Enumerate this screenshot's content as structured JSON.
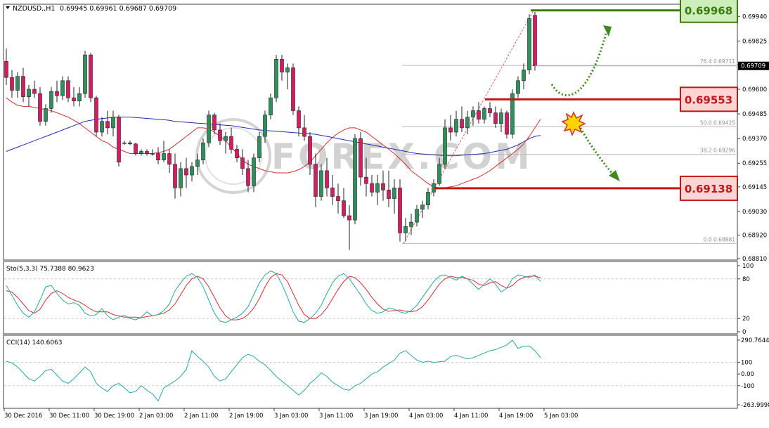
{
  "chart_data": {
    "type": "candlestick",
    "symbol_header": "NZDUSD,,H1",
    "ohlc_header": "0.69945 0.69961 0.69687 0.69709",
    "main": {
      "ylim": [
        0.6881,
        0.6999
      ],
      "yticks": [
        0.6881,
        0.6892,
        0.6903,
        0.69145,
        0.69255,
        0.6937,
        0.69485,
        0.696,
        0.69715,
        0.69825,
        0.6994
      ],
      "ytick_labels": [
        "0.68810",
        "0.68920",
        "0.69030",
        "0.69145",
        "0.69255",
        "0.69370",
        "0.69485",
        "0.69600",
        "0.69715",
        "0.69825",
        "0.69940"
      ],
      "current_price": 0.69709,
      "current_price_label": "0.69709",
      "fib_levels": [
        {
          "label": "76.4  0.69711",
          "value": 0.69711
        },
        {
          "label": "50.0  0.69425",
          "value": 0.69425
        },
        {
          "label": "38.2  0.69296",
          "value": 0.69296
        },
        {
          "label": "0.0  0.68881",
          "value": 0.68881
        }
      ],
      "levels": [
        {
          "label": "0.69968",
          "value": 0.69968,
          "kind": "resistance",
          "color": "#3a7a10",
          "fill": "#cdeeb8"
        },
        {
          "label": "0.69553",
          "value": 0.69553,
          "kind": "pivot",
          "color": "#c01818",
          "fill": "#ffd4d4"
        },
        {
          "label": "0.69138",
          "value": 0.69138,
          "kind": "support",
          "color": "#c01818",
          "fill": "#ffd4d4"
        }
      ],
      "candles": [
        [
          0.6973,
          0.6979,
          0.6962,
          0.69655
        ],
        [
          0.69655,
          0.6969,
          0.6956,
          0.69595
        ],
        [
          0.69595,
          0.6968,
          0.6956,
          0.6966
        ],
        [
          0.6966,
          0.697,
          0.6954,
          0.69565
        ],
        [
          0.69565,
          0.6962,
          0.6952,
          0.696
        ],
        [
          0.696,
          0.6964,
          0.6956,
          0.6958
        ],
        [
          0.6958,
          0.6961,
          0.6943,
          0.6945
        ],
        [
          0.6945,
          0.6953,
          0.6943,
          0.6951
        ],
        [
          0.6951,
          0.6961,
          0.6949,
          0.6959
        ],
        [
          0.6959,
          0.6964,
          0.6954,
          0.6957
        ],
        [
          0.6957,
          0.6966,
          0.6955,
          0.6964
        ],
        [
          0.6964,
          0.6966,
          0.6954,
          0.6956
        ],
        [
          0.6956,
          0.6961,
          0.6952,
          0.69545
        ],
        [
          0.69545,
          0.6961,
          0.6952,
          0.6958
        ],
        [
          0.6958,
          0.6978,
          0.6956,
          0.6976
        ],
        [
          0.6976,
          0.6977,
          0.6954,
          0.6956
        ],
        [
          0.6956,
          0.6957,
          0.6938,
          0.694
        ],
        [
          0.694,
          0.6947,
          0.6938,
          0.6945
        ],
        [
          0.6945,
          0.695,
          0.6939,
          0.6942
        ],
        [
          0.6942,
          0.695,
          0.6938,
          0.6947
        ],
        [
          0.6947,
          0.6948,
          0.6924,
          0.6926
        ],
        [
          0.6935,
          0.6936,
          0.6934,
          0.6935
        ],
        [
          0.6935,
          0.6936,
          0.6934,
          0.69345
        ],
        [
          0.69345,
          0.6935,
          0.6929,
          0.693
        ],
        [
          0.693,
          0.6932,
          0.6929,
          0.6931
        ],
        [
          0.6931,
          0.6932,
          0.6929,
          0.693
        ],
        [
          0.693,
          0.6932,
          0.6929,
          0.693
        ],
        [
          0.693,
          0.6933,
          0.6925,
          0.6927
        ],
        [
          0.6927,
          0.6936,
          0.6926,
          0.693
        ],
        [
          0.693,
          0.6932,
          0.6921,
          0.6925
        ],
        [
          0.6925,
          0.693,
          0.6909,
          0.6914
        ],
        [
          0.6914,
          0.6926,
          0.691,
          0.6923
        ],
        [
          0.6923,
          0.6928,
          0.6914,
          0.692
        ],
        [
          0.692,
          0.6926,
          0.6917,
          0.6924
        ],
        [
          0.6924,
          0.693,
          0.692,
          0.6927
        ],
        [
          0.6927,
          0.6937,
          0.6925,
          0.6935
        ],
        [
          0.6935,
          0.695,
          0.6933,
          0.6948
        ],
        [
          0.6948,
          0.6949,
          0.6939,
          0.6941
        ],
        [
          0.6941,
          0.6944,
          0.6934,
          0.6936
        ],
        [
          0.6936,
          0.694,
          0.693,
          0.6938
        ],
        [
          0.6938,
          0.6942,
          0.693,
          0.6932
        ],
        [
          0.6932,
          0.6934,
          0.6926,
          0.6928
        ],
        [
          0.6928,
          0.6932,
          0.692,
          0.6923
        ],
        [
          0.6923,
          0.6927,
          0.6912,
          0.6915
        ],
        [
          0.6915,
          0.693,
          0.6912,
          0.6928
        ],
        [
          0.6928,
          0.694,
          0.6926,
          0.6938
        ],
        [
          0.6938,
          0.695,
          0.6935,
          0.6948
        ],
        [
          0.6948,
          0.6958,
          0.6946,
          0.6956
        ],
        [
          0.6956,
          0.6976,
          0.6954,
          0.6974
        ],
        [
          0.6974,
          0.6976,
          0.6964,
          0.6968
        ],
        [
          0.6968,
          0.6972,
          0.696,
          0.697
        ],
        [
          0.697,
          0.6972,
          0.6948,
          0.695
        ],
        [
          0.695,
          0.6952,
          0.6938,
          0.6942
        ],
        [
          0.6942,
          0.6948,
          0.6936,
          0.6938
        ],
        [
          0.6938,
          0.694,
          0.692,
          0.6925
        ],
        [
          0.6925,
          0.693,
          0.6905,
          0.691
        ],
        [
          0.691,
          0.6925,
          0.6908,
          0.6922
        ],
        [
          0.6922,
          0.6928,
          0.691,
          0.6914
        ],
        [
          0.6914,
          0.692,
          0.6906,
          0.691
        ],
        [
          0.691,
          0.6916,
          0.6902,
          0.6908
        ],
        [
          0.6908,
          0.6914,
          0.69,
          0.6901
        ],
        [
          0.6901,
          0.6906,
          0.6885,
          0.6899
        ],
        [
          0.6899,
          0.6939,
          0.6897,
          0.6937
        ],
        [
          0.6937,
          0.694,
          0.6915,
          0.6919
        ],
        [
          0.6919,
          0.6928,
          0.691,
          0.6916
        ],
        [
          0.6916,
          0.692,
          0.691,
          0.6912
        ],
        [
          0.6912,
          0.692,
          0.6906,
          0.6916
        ],
        [
          0.6916,
          0.6922,
          0.6908,
          0.6913
        ],
        [
          0.6913,
          0.6922,
          0.6905,
          0.6909
        ],
        [
          0.6909,
          0.6918,
          0.6902,
          0.6914
        ],
        [
          0.6914,
          0.6918,
          0.6889,
          0.6893
        ],
        [
          0.6893,
          0.69,
          0.6889,
          0.6896
        ],
        [
          0.6896,
          0.6902,
          0.6892,
          0.6898
        ],
        [
          0.6898,
          0.6906,
          0.6896,
          0.6904
        ],
        [
          0.6904,
          0.6908,
          0.69,
          0.6906
        ],
        [
          0.6906,
          0.6914,
          0.6904,
          0.6912
        ],
        [
          0.6912,
          0.6918,
          0.691,
          0.6916
        ],
        [
          0.6916,
          0.6928,
          0.6915,
          0.6925
        ],
        [
          0.6925,
          0.6946,
          0.6923,
          0.6942
        ],
        [
          0.6942,
          0.6948,
          0.6936,
          0.694
        ],
        [
          0.694,
          0.695,
          0.6938,
          0.6946
        ],
        [
          0.6946,
          0.6952,
          0.694,
          0.6942
        ],
        [
          0.6942,
          0.695,
          0.6939,
          0.6947
        ],
        [
          0.6947,
          0.6952,
          0.6943,
          0.695
        ],
        [
          0.695,
          0.6954,
          0.6944,
          0.6946
        ],
        [
          0.6946,
          0.6952,
          0.6944,
          0.6951
        ],
        [
          0.6951,
          0.6954,
          0.6947,
          0.6949
        ],
        [
          0.6949,
          0.6952,
          0.6942,
          0.6944
        ],
        [
          0.6944,
          0.6951,
          0.694,
          0.6949
        ],
        [
          0.6949,
          0.695,
          0.6937,
          0.6939
        ],
        [
          0.6939,
          0.696,
          0.6937,
          0.6958
        ],
        [
          0.6958,
          0.6966,
          0.6956,
          0.6964
        ],
        [
          0.6964,
          0.6972,
          0.696,
          0.6969
        ],
        [
          0.6969,
          0.6995,
          0.6967,
          0.6993
        ],
        [
          0.69945,
          0.69961,
          0.69687,
          0.69709
        ]
      ],
      "ma_fast": [
        0.6956,
        0.6954,
        0.69525,
        0.6952,
        0.6952,
        0.69515,
        0.6951,
        0.69505,
        0.695,
        0.6949,
        0.6948,
        0.6947,
        0.69455,
        0.6944,
        0.6942,
        0.694,
        0.6938,
        0.6936,
        0.6935,
        0.6933,
        0.6932,
        0.6931,
        0.693,
        0.693,
        0.693,
        0.693,
        0.693,
        0.69305,
        0.6931,
        0.6932,
        0.6934,
        0.6936,
        0.6938,
        0.694,
        0.6942,
        0.6942,
        0.69415,
        0.694,
        0.6938,
        0.6936,
        0.6933,
        0.693,
        0.6927,
        0.6925,
        0.6924,
        0.6923,
        0.6922,
        0.69215,
        0.6921,
        0.6921,
        0.6921,
        0.69215,
        0.69225,
        0.6924,
        0.6926,
        0.6929,
        0.6932,
        0.6935,
        0.69375,
        0.69395,
        0.6941,
        0.6942,
        0.6942,
        0.6941,
        0.694,
        0.6938,
        0.6936,
        0.6934,
        0.6932,
        0.693,
        0.69275,
        0.6925,
        0.6922,
        0.692,
        0.6918,
        0.6916,
        0.69145,
        0.6914,
        0.6914,
        0.69145,
        0.6915,
        0.6916,
        0.6917,
        0.6918,
        0.6919,
        0.69205,
        0.6922,
        0.6924,
        0.6926,
        0.6928,
        0.693,
        0.6932,
        0.69345,
        0.6938,
        0.6942,
        0.6946
      ],
      "ma_slow": [
        0.6931,
        0.6932,
        0.6933,
        0.6934,
        0.6935,
        0.6936,
        0.6937,
        0.6938,
        0.6939,
        0.694,
        0.6941,
        0.6942,
        0.6943,
        0.6944,
        0.6945,
        0.69455,
        0.6946,
        0.69463,
        0.69466,
        0.69469,
        0.6947,
        0.6947,
        0.6947,
        0.69468,
        0.69466,
        0.69464,
        0.69462,
        0.6946,
        0.69458,
        0.69455,
        0.6945,
        0.69448,
        0.69446,
        0.69444,
        0.69442,
        0.6944,
        0.69438,
        0.69436,
        0.69434,
        0.69432,
        0.6943,
        0.69426,
        0.69422,
        0.69418,
        0.69414,
        0.6941,
        0.69408,
        0.69406,
        0.69404,
        0.69402,
        0.694,
        0.69398,
        0.69396,
        0.69394,
        0.69392,
        0.6939,
        0.69385,
        0.6938,
        0.69375,
        0.6937,
        0.69365,
        0.6936,
        0.69355,
        0.6935,
        0.69345,
        0.6934,
        0.69335,
        0.6933,
        0.69325,
        0.6932,
        0.69315,
        0.6931,
        0.69305,
        0.693,
        0.69298,
        0.69296,
        0.69294,
        0.69292,
        0.6929,
        0.6929,
        0.6929,
        0.69292,
        0.69294,
        0.69296,
        0.69298,
        0.693,
        0.69305,
        0.6931,
        0.69315,
        0.6932,
        0.6933,
        0.6934,
        0.69355,
        0.6937,
        0.6938,
        0.69385
      ]
    },
    "stoch": {
      "label": "Sto(5,3,3) 75.7388 80.9623",
      "ylim": [
        0,
        100
      ],
      "levels": [
        80,
        20
      ],
      "ticks": [
        100,
        80,
        20,
        0
      ],
      "tick_labels": [
        "100",
        "80",
        "20",
        "0"
      ],
      "k": [
        70,
        55,
        40,
        28,
        22,
        30,
        48,
        68,
        70,
        58,
        48,
        42,
        44,
        40,
        28,
        24,
        26,
        35,
        24,
        18,
        22,
        25,
        20,
        18,
        22,
        30,
        24,
        26,
        32,
        42,
        62,
        74,
        84,
        88,
        82,
        68,
        48,
        28,
        16,
        14,
        18,
        22,
        28,
        38,
        56,
        74,
        86,
        92,
        88,
        72,
        52,
        30,
        16,
        14,
        20,
        28,
        40,
        58,
        74,
        84,
        88,
        80,
        68,
        56,
        42,
        32,
        28,
        30,
        36,
        34,
        30,
        28,
        32,
        40,
        52,
        64,
        76,
        84,
        86,
        82,
        78,
        84,
        80,
        72,
        64,
        72,
        80,
        72,
        60,
        66,
        80,
        86,
        84,
        82,
        86,
        76
      ],
      "d": [
        62,
        60,
        52,
        42,
        32,
        28,
        34,
        48,
        58,
        62,
        58,
        52,
        48,
        45,
        40,
        34,
        30,
        30,
        30,
        26,
        24,
        22,
        22,
        22,
        21,
        23,
        24,
        26,
        28,
        33,
        42,
        56,
        70,
        80,
        84,
        80,
        68,
        52,
        36,
        24,
        18,
        18,
        20,
        26,
        36,
        50,
        68,
        82,
        88,
        86,
        76,
        58,
        40,
        26,
        20,
        20,
        26,
        36,
        50,
        64,
        76,
        84,
        82,
        74,
        64,
        52,
        42,
        34,
        31,
        32,
        33,
        31,
        30,
        32,
        38,
        48,
        60,
        72,
        80,
        84,
        82,
        82,
        80,
        78,
        72,
        70,
        74,
        76,
        70,
        66,
        70,
        78,
        82,
        84,
        84,
        82
      ]
    },
    "cci": {
      "label": "CCI(14) 140.6063",
      "ylim": [
        -263.9998,
        290.7644
      ],
      "levels": [
        100,
        -100
      ],
      "ticks": [
        290.7644,
        100,
        0,
        -100,
        -263.9998
      ],
      "tick_labels": [
        "290.7644",
        "100",
        "0.00",
        "-100",
        "-263.9998"
      ],
      "values": [
        110,
        95,
        60,
        10,
        -40,
        -60,
        -20,
        30,
        40,
        -10,
        -60,
        -80,
        -40,
        10,
        60,
        20,
        -80,
        -120,
        -150,
        -100,
        -80,
        -120,
        -160,
        -150,
        -100,
        -140,
        -170,
        -230,
        -120,
        -90,
        -60,
        -20,
        40,
        200,
        150,
        110,
        60,
        -20,
        -60,
        -40,
        20,
        80,
        140,
        170,
        150,
        110,
        80,
        30,
        -20,
        -60,
        -100,
        -140,
        -180,
        -140,
        -80,
        -40,
        10,
        -20,
        -70,
        -100,
        -130,
        -140,
        -100,
        -80,
        -40,
        0,
        20,
        60,
        90,
        120,
        180,
        200,
        160,
        120,
        100,
        110,
        100,
        105,
        110,
        150,
        160,
        145,
        130,
        140,
        160,
        180,
        200,
        210,
        230,
        250,
        290,
        220,
        240,
        240,
        200,
        140
      ]
    },
    "x_labels": [
      "30 Dec 2016",
      "30 Dec 11:00",
      "30 Dec 19:00",
      "2 Jan 03:00",
      "2 Jan 11:00",
      "2 Jan 19:00",
      "3 Jan 03:00",
      "3 Jan 11:00",
      "3 Jan 19:00",
      "4 Jan 03:00",
      "4 Jan 11:00",
      "4 Jan 19:00",
      "5 Jan 03:00"
    ],
    "watermark": "FOREX.COM"
  },
  "colors": {
    "bull": "#2f8f5a",
    "bear": "#d81b60",
    "ma_fast": "#d32f2f",
    "ma_slow": "#1f2fb0",
    "stoch_k": "#27a6a6",
    "stoch_d": "#d32f2f",
    "cci": "#27a6a6",
    "arrow": "#3f8a1e",
    "grid": "#c8c8c8"
  }
}
